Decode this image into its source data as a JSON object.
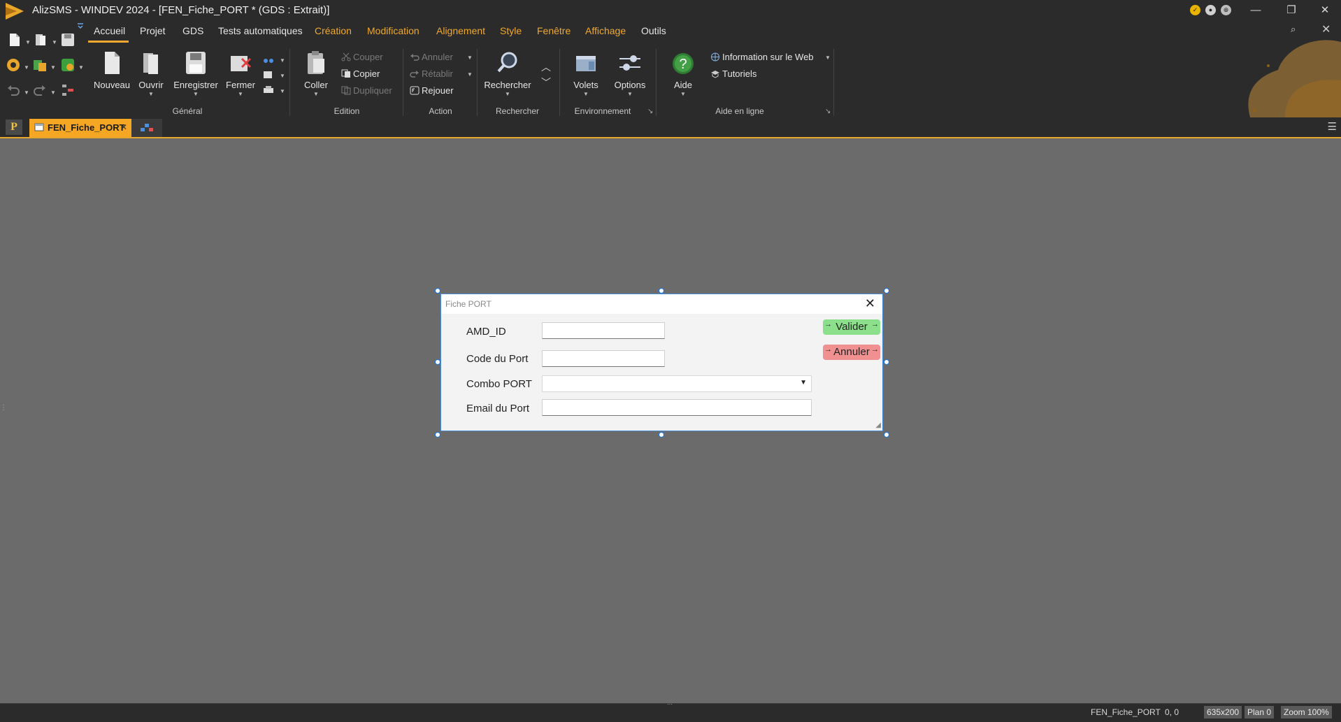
{
  "titlebar": {
    "title": "AlizSMS - WINDEV 2024 - [FEN_Fiche_PORT * (GDS : Extrait)]",
    "minimize": "—",
    "restore": "❐",
    "close": "✕"
  },
  "ribbon": {
    "tabs": [
      "Accueil",
      "Projet",
      "GDS",
      "Tests automatiques",
      "Création",
      "Modification",
      "Alignement",
      "Style",
      "Fenêtre",
      "Affichage",
      "Outils"
    ],
    "active_tab": "Accueil",
    "general": {
      "label": "Général",
      "nouveau": "Nouveau",
      "ouvrir": "Ouvrir",
      "enregistrer": "Enregistrer",
      "fermer": "Fermer"
    },
    "edition": {
      "label": "Edition",
      "coller": "Coller",
      "couper": "Couper",
      "copier": "Copier",
      "dupliquer": "Dupliquer"
    },
    "action": {
      "label": "Action",
      "annuler": "Annuler",
      "retablir": "Rétablir",
      "rejouer": "Rejouer"
    },
    "rechercher": {
      "label": "Rechercher",
      "rechercher": "Rechercher"
    },
    "environnement": {
      "label": "Environnement",
      "volets": "Volets",
      "options": "Options"
    },
    "aide": {
      "label": "Aide en ligne",
      "aide": "Aide",
      "info_web": "Information sur le Web",
      "tutoriels": "Tutoriels"
    }
  },
  "doc_tabs": {
    "project_letter": "P",
    "active_tab": "FEN_Fiche_PORT",
    "close": "✕"
  },
  "form": {
    "title": "Fiche PORT",
    "close": "✕",
    "fields": [
      {
        "label": "AMD_ID",
        "value": ""
      },
      {
        "label": "Code du Port",
        "value": ""
      },
      {
        "label": "Combo PORT",
        "value": ""
      },
      {
        "label": "Email du Port",
        "value": ""
      }
    ],
    "valider": "Valider",
    "annuler": "Annuler"
  },
  "status": {
    "window_name": "FEN_Fiche_PORT",
    "position": "0, 0",
    "size": "635x200",
    "plan": "Plan 0",
    "zoom": "Zoom 100%"
  },
  "colors": {
    "accent": "#f0a830",
    "selection": "#1a73e8",
    "valider_bg": "#8ce08c",
    "annuler_bg": "#f09090"
  }
}
